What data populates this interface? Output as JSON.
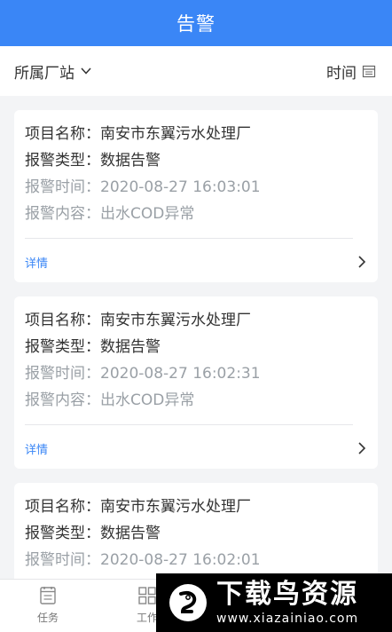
{
  "header": {
    "title": "告警"
  },
  "filters": {
    "station_label": "所属厂站",
    "time_label": "时间"
  },
  "alerts": [
    {
      "project_label": "项目名称：",
      "project_value": "南安市东翼污水处理厂",
      "type_label": "报警类型：",
      "type_value": "数据告警",
      "time_label": "报警时间：",
      "time_value": "2020-08-27 16:03:01",
      "content_label": "报警内容：",
      "content_value": "出水COD异常",
      "detail_label": "详情"
    },
    {
      "project_label": "项目名称：",
      "project_value": "南安市东翼污水处理厂",
      "type_label": "报警类型：",
      "type_value": "数据告警",
      "time_label": "报警时间：",
      "time_value": "2020-08-27 16:02:31",
      "content_label": "报警内容：",
      "content_value": "出水COD异常",
      "detail_label": "详情"
    },
    {
      "project_label": "项目名称：",
      "project_value": "南安市东翼污水处理厂",
      "type_label": "报警类型：",
      "type_value": "数据告警",
      "time_label": "报警时间：",
      "time_value": "2020-08-27 16:02:01"
    }
  ],
  "tabbar": {
    "tasks_label": "任务",
    "work_label": "工作"
  },
  "watermark": {
    "title": "下载鸟资源",
    "url": "www.xiazainiao.com"
  },
  "colors": {
    "accent": "#3a86f6",
    "muted": "#9aa0a6",
    "background": "#f3f4f6"
  },
  "icons": {
    "station_dropdown": "chevron-down-icon",
    "time": "calendar-icon",
    "detail": "chevron-right-icon",
    "tasks": "task-list-icon",
    "work": "grid-icon"
  }
}
